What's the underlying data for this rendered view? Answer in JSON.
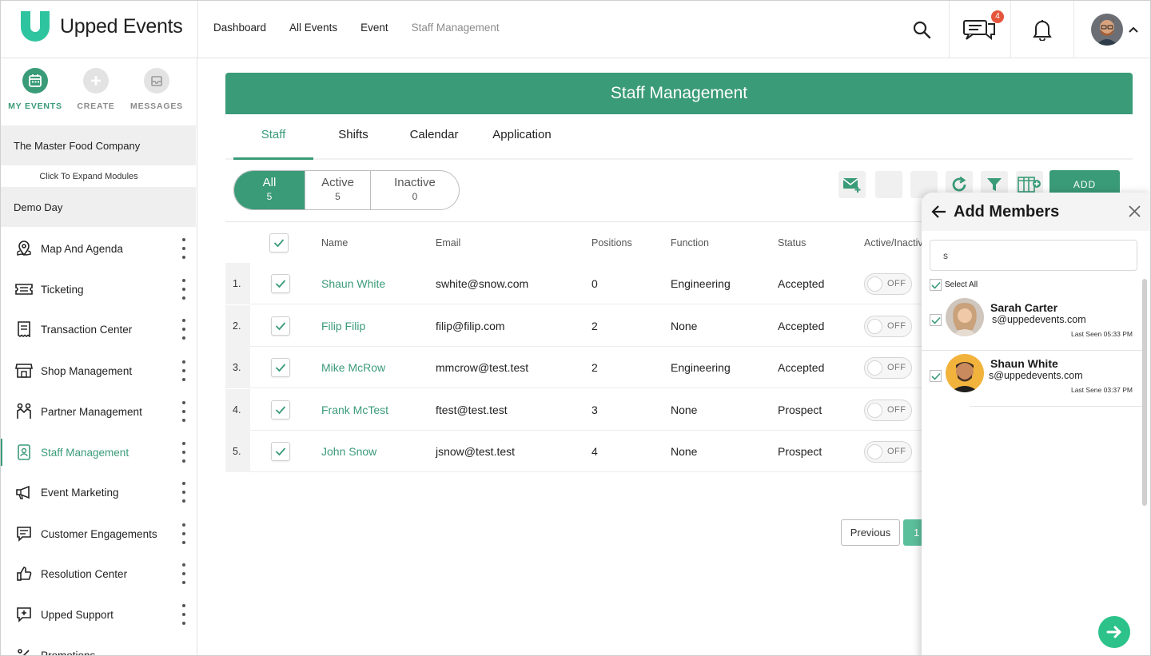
{
  "app": {
    "brand": "Upped Events"
  },
  "topnav": [
    "Dashboard",
    "All Events",
    "Event",
    "Staff Management"
  ],
  "header": {
    "chat_badge": "4"
  },
  "modes": [
    {
      "label": "MY EVENTS",
      "icon": "calendar-icon"
    },
    {
      "label": "CREATE",
      "icon": "plus-icon"
    },
    {
      "label": "MESSAGES",
      "icon": "inbox-icon"
    }
  ],
  "sidebar": {
    "org": "The Master Food Company",
    "expand": "Click To Expand Modules",
    "event": "Demo Day",
    "items": [
      {
        "label": "Map And Agenda",
        "icon": "map-pin-icon"
      },
      {
        "label": "Ticketing",
        "icon": "ticket-icon"
      },
      {
        "label": "Transaction Center",
        "icon": "receipt-icon"
      },
      {
        "label": "Shop Management",
        "icon": "storefront-icon"
      },
      {
        "label": "Partner Management",
        "icon": "handshake-icon"
      },
      {
        "label": "Staff Management",
        "icon": "badge-icon"
      },
      {
        "label": "Event Marketing",
        "icon": "megaphone-icon"
      },
      {
        "label": "Customer Engagements",
        "icon": "chat-icon"
      },
      {
        "label": "Resolution Center",
        "icon": "thumbs-up-icon"
      },
      {
        "label": "Upped Support",
        "icon": "support-icon"
      },
      {
        "label": "Promotions",
        "icon": "percent-icon"
      }
    ]
  },
  "page": {
    "title": "Staff Management",
    "tabs": [
      "Staff",
      "Shifts",
      "Calendar",
      "Application"
    ],
    "filters": [
      {
        "label": "All",
        "count": "5"
      },
      {
        "label": "Active",
        "count": "5"
      },
      {
        "label": "Inactive",
        "count": "0"
      }
    ],
    "add_label": "ADD"
  },
  "table": {
    "columns": [
      "Name",
      "Email",
      "Positions",
      "Function",
      "Status",
      "Active/Inactive"
    ],
    "rows": [
      {
        "num": "1.",
        "name": "Shaun White",
        "email": "swhite@snow.com",
        "positions": "0",
        "function": "Engineering",
        "status": "Accepted",
        "toggle": "OFF"
      },
      {
        "num": "2.",
        "name": "Filip Filip",
        "email": "filip@filip.com",
        "positions": "2",
        "function": "None",
        "status": "Accepted",
        "toggle": "OFF"
      },
      {
        "num": "3.",
        "name": "Mike McRow",
        "email": "mmcrow@test.test",
        "positions": "2",
        "function": "Engineering",
        "status": "Accepted",
        "toggle": "OFF"
      },
      {
        "num": "4.",
        "name": "Frank McTest",
        "email": "ftest@test.test",
        "positions": "3",
        "function": "None",
        "status": "Prospect",
        "toggle": "OFF"
      },
      {
        "num": "5.",
        "name": "John Snow",
        "email": "jsnow@test.test",
        "positions": "4",
        "function": "None",
        "status": "Prospect",
        "toggle": "OFF"
      }
    ]
  },
  "pager": {
    "prev": "Previous",
    "page": "1"
  },
  "panel": {
    "title": "Add Members",
    "search_value": "s",
    "select_all": "Select All",
    "members": [
      {
        "name": "Sarah Carter",
        "email": "s@uppedevents.com",
        "seen": "Last Seen 05:33 PM"
      },
      {
        "name": "Shaun White",
        "email": "s@uppedevents.com",
        "seen": "Last Sene 03:37 PM"
      }
    ]
  },
  "colors": {
    "accent": "#3a9b78",
    "accent_light": "#5cbf9c",
    "go": "#2cc28a",
    "badge": "#e4553b"
  }
}
